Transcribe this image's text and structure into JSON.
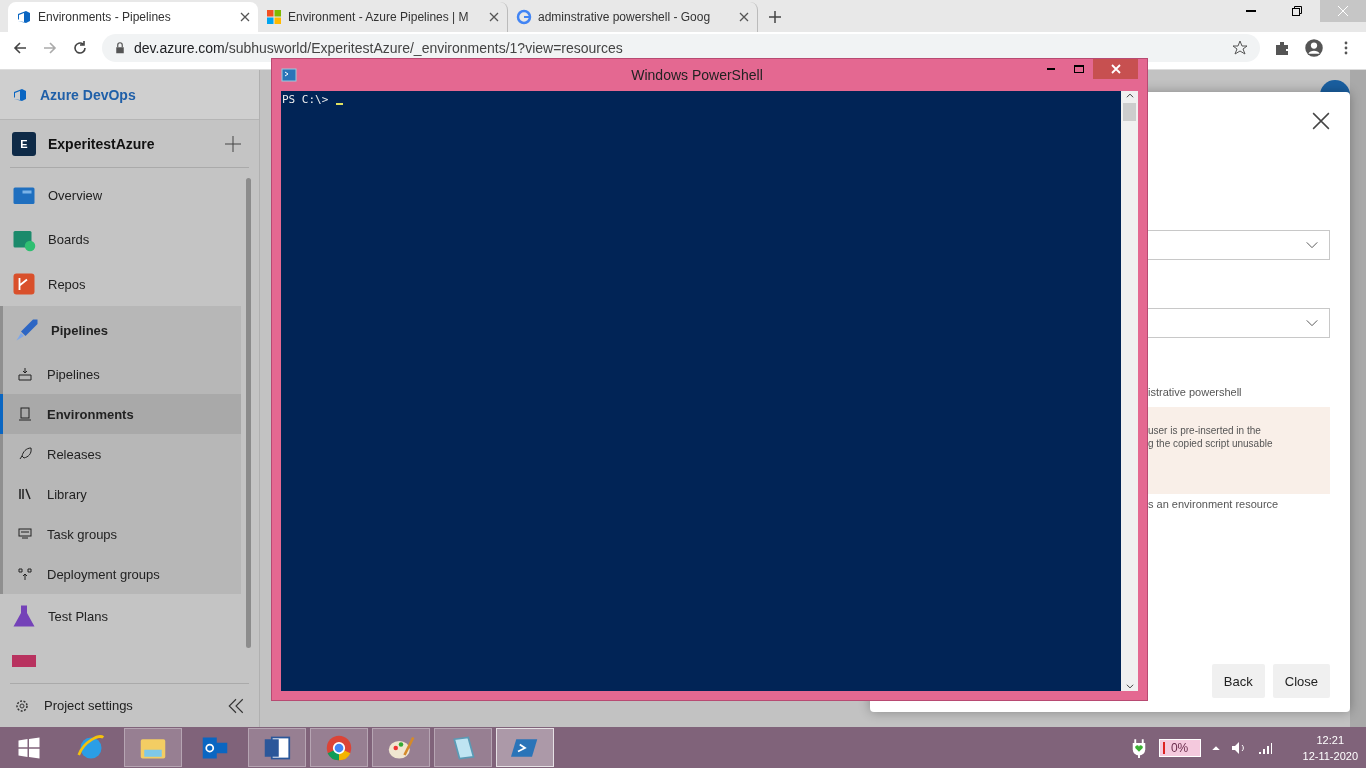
{
  "browser": {
    "tabs": [
      {
        "title": "Environments - Pipelines",
        "selected": true
      },
      {
        "title": "Environment - Azure Pipelines | M",
        "selected": false
      },
      {
        "title": "adminstrative powershell - Goog",
        "selected": false
      }
    ],
    "url_host": "dev.azure.com",
    "url_path": "/subhusworld/ExperitestAzure/_environments/1?view=resources"
  },
  "sidebar": {
    "brand": "Azure DevOps",
    "project": {
      "initial": "E",
      "name": "ExperitestAzure"
    },
    "items": [
      {
        "label": "Overview",
        "expanded": false
      },
      {
        "label": "Boards",
        "expanded": false
      },
      {
        "label": "Repos",
        "expanded": false
      },
      {
        "label": "Pipelines",
        "expanded": true,
        "children": [
          {
            "label": "Pipelines",
            "selected": false
          },
          {
            "label": "Environments",
            "selected": true
          },
          {
            "label": "Releases",
            "selected": false
          },
          {
            "label": "Library",
            "selected": false
          },
          {
            "label": "Task groups",
            "selected": false
          },
          {
            "label": "Deployment groups",
            "selected": false
          }
        ]
      },
      {
        "label": "Test Plans",
        "expanded": false
      }
    ],
    "footer": "Project settings"
  },
  "dialog": {
    "lines": [
      {
        "kind": "dropdown"
      },
      {
        "kind": "dropdown"
      },
      {
        "kind": "text",
        "text": "istrative powershell"
      },
      {
        "kind": "warning",
        "texts": [
          "user is pre-inserted in the",
          "g the copied script unusable"
        ]
      },
      {
        "kind": "text",
        "text": "s an environment resource"
      }
    ],
    "buttons": [
      "Back",
      "Close"
    ]
  },
  "powershell": {
    "title": "Windows PowerShell",
    "prompt": "PS C:\\>"
  },
  "taskbar": {
    "apps": [
      {
        "running": false,
        "selected": false
      },
      {
        "running": true,
        "selected": false
      },
      {
        "running": false,
        "selected": false
      },
      {
        "running": true,
        "selected": false
      },
      {
        "running": true,
        "selected": false
      },
      {
        "running": true,
        "selected": false
      },
      {
        "running": true,
        "selected": false
      },
      {
        "running": true,
        "selected": true
      }
    ],
    "battery": "0%",
    "time": "12:21",
    "date": "12-11-2020"
  }
}
